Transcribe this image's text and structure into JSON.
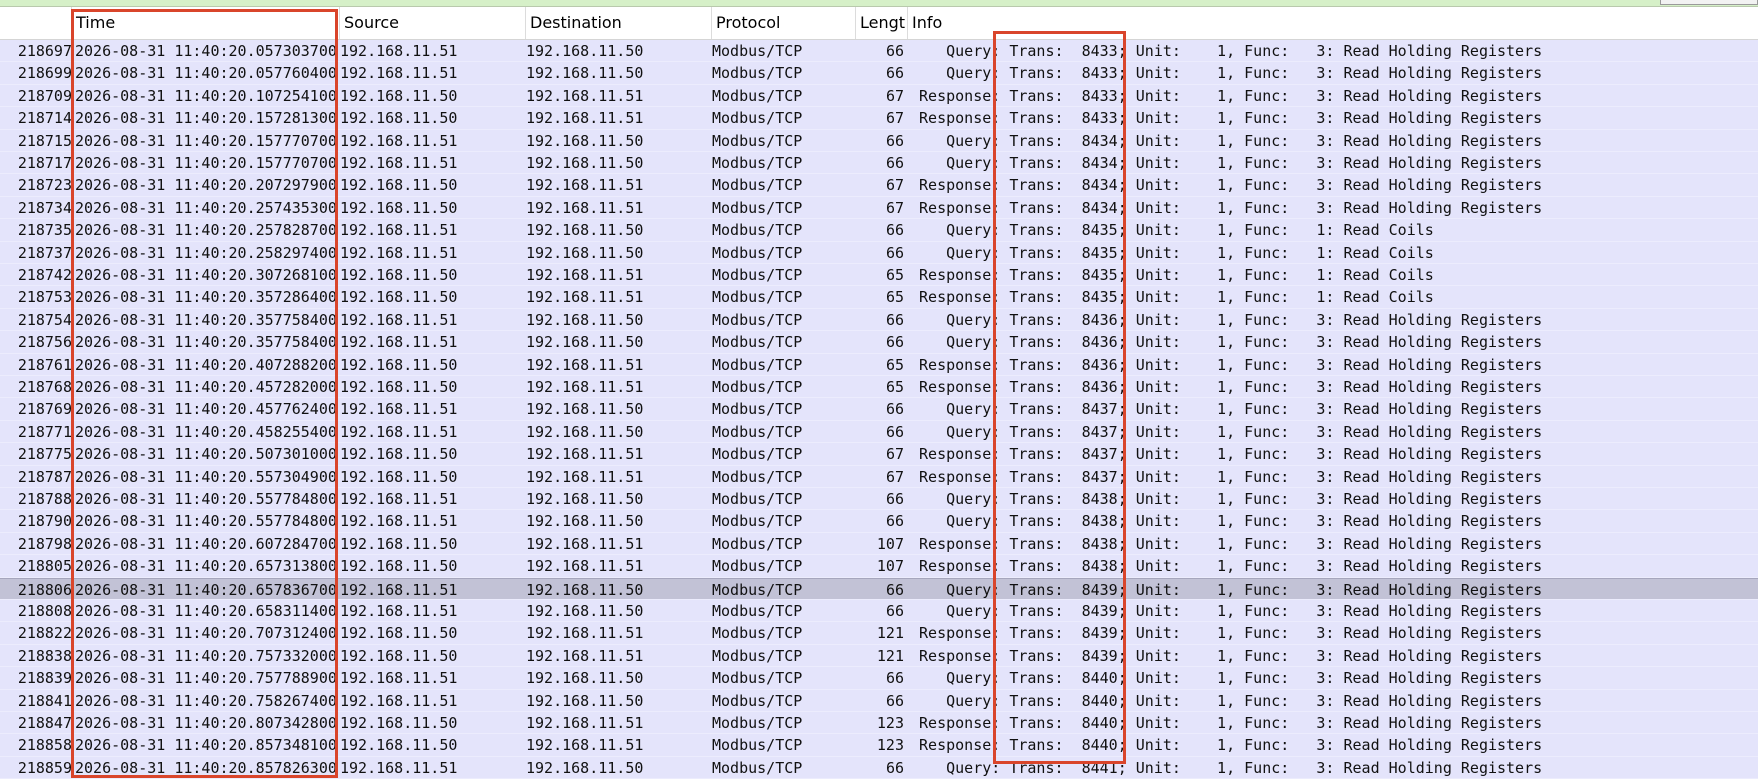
{
  "columns": {
    "time": "Time",
    "source": "Source",
    "destination": "Destination",
    "protocol": "Protocol",
    "length": "Lengt",
    "info": "Info"
  },
  "highlight_color": "#d9452b",
  "row_color": "#e4e4fb",
  "selected_row_color": "#c2c2d6",
  "time_prefix": "2026-08-31 11:40:20.",
  "ip_a": "192.168.11.51",
  "ip_b": "192.168.11.50",
  "protocol": "Modbus/TCP",
  "rows": [
    [
      "218697",
      "057303700",
      "a",
      "66",
      "Q",
      "8433",
      "3"
    ],
    [
      "218699",
      "057760400",
      "a",
      "66",
      "Q",
      "8433",
      "3"
    ],
    [
      "218709",
      "107254100",
      "b",
      "67",
      "R",
      "8433",
      "3"
    ],
    [
      "218714",
      "157281300",
      "b",
      "67",
      "R",
      "8433",
      "3"
    ],
    [
      "218715",
      "157770700",
      "a",
      "66",
      "Q",
      "8434",
      "3"
    ],
    [
      "218717",
      "157770700",
      "a",
      "66",
      "Q",
      "8434",
      "3"
    ],
    [
      "218723",
      "207297900",
      "b",
      "67",
      "R",
      "8434",
      "3"
    ],
    [
      "218734",
      "257435300",
      "b",
      "67",
      "R",
      "8434",
      "3"
    ],
    [
      "218735",
      "257828700",
      "a",
      "66",
      "Q",
      "8435",
      "1"
    ],
    [
      "218737",
      "258297400",
      "a",
      "66",
      "Q",
      "8435",
      "1"
    ],
    [
      "218742",
      "307268100",
      "b",
      "65",
      "R",
      "8435",
      "1"
    ],
    [
      "218753",
      "357286400",
      "b",
      "65",
      "R",
      "8435",
      "1"
    ],
    [
      "218754",
      "357758400",
      "a",
      "66",
      "Q",
      "8436",
      "3"
    ],
    [
      "218756",
      "357758400",
      "a",
      "66",
      "Q",
      "8436",
      "3"
    ],
    [
      "218761",
      "407288200",
      "b",
      "65",
      "R",
      "8436",
      "3"
    ],
    [
      "218768",
      "457282000",
      "b",
      "65",
      "R",
      "8436",
      "3"
    ],
    [
      "218769",
      "457762400",
      "a",
      "66",
      "Q",
      "8437",
      "3"
    ],
    [
      "218771",
      "458255400",
      "a",
      "66",
      "Q",
      "8437",
      "3"
    ],
    [
      "218775",
      "507301000",
      "b",
      "67",
      "R",
      "8437",
      "3"
    ],
    [
      "218787",
      "557304900",
      "b",
      "67",
      "R",
      "8437",
      "3"
    ],
    [
      "218788",
      "557784800",
      "a",
      "66",
      "Q",
      "8438",
      "3"
    ],
    [
      "218790",
      "557784800",
      "a",
      "66",
      "Q",
      "8438",
      "3"
    ],
    [
      "218798",
      "607284700",
      "b",
      "107",
      "R",
      "8438",
      "3"
    ],
    [
      "218805",
      "657313800",
      "b",
      "107",
      "R",
      "8438",
      "3"
    ],
    [
      "218806",
      "657836700",
      "a",
      "66",
      "Q",
      "8439",
      "3"
    ],
    [
      "218808",
      "658311400",
      "a",
      "66",
      "Q",
      "8439",
      "3"
    ],
    [
      "218822",
      "707312400",
      "b",
      "121",
      "R",
      "8439",
      "3"
    ],
    [
      "218838",
      "757332000",
      "b",
      "121",
      "R",
      "8439",
      "3"
    ],
    [
      "218839",
      "757788900",
      "a",
      "66",
      "Q",
      "8440",
      "3"
    ],
    [
      "218841",
      "758267400",
      "a",
      "66",
      "Q",
      "8440",
      "3"
    ],
    [
      "218847",
      "807342800",
      "b",
      "123",
      "R",
      "8440",
      "3"
    ],
    [
      "218858",
      "857348100",
      "b",
      "123",
      "R",
      "8440",
      "3"
    ],
    [
      "218859",
      "857826300",
      "a",
      "66",
      "Q",
      "8441",
      "3"
    ]
  ],
  "selected_row": "218806",
  "info_words": {
    "Q": "Query",
    "R": "Response",
    "trans": "Trans:",
    "unit": "Unit:",
    "unit_value": "1",
    "func": "Func:"
  },
  "func_names": {
    "1": "Read Coils",
    "3": "Read Holding Registers"
  }
}
